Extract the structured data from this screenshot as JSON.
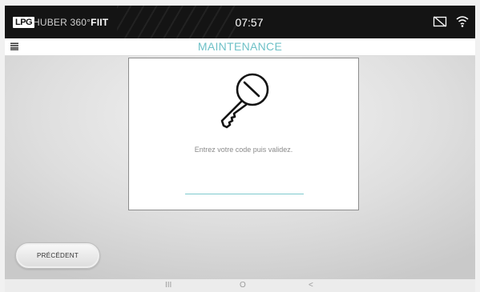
{
  "topbar": {
    "logo": "LPG",
    "brand_name": "HUBER 360°",
    "brand_suffix": "FIIT",
    "clock": "07:57",
    "icons": [
      "screen-off-icon",
      "wifi-icon"
    ]
  },
  "header": {
    "menu_icon": "hamburger-menu-icon",
    "title": "MAINTENANCE",
    "title_color": "#6ec1c7"
  },
  "dialog": {
    "icon": "key-icon",
    "prompt": "Entrez votre code puis validez.",
    "code_value": "",
    "accent_color": "#7ec9cd"
  },
  "footer": {
    "previous_label": "PRÉCÉDENT"
  },
  "navbar": {
    "recent": "III",
    "home": "O",
    "back": "<"
  }
}
